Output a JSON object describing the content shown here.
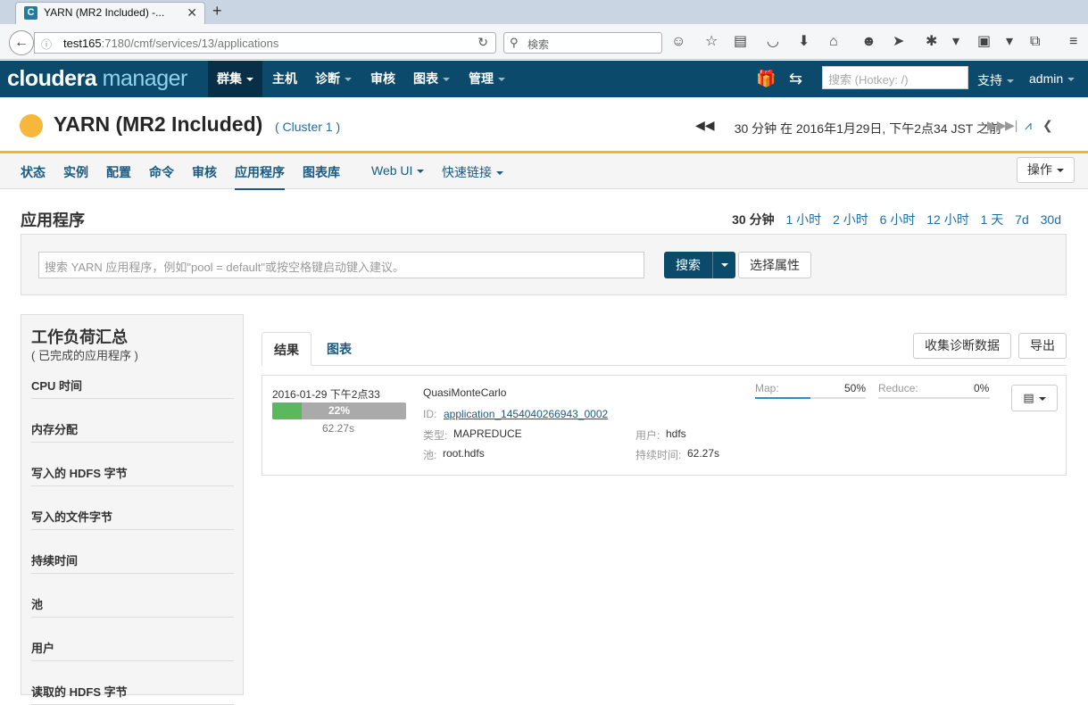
{
  "browser": {
    "tab_title": "YARN (MR2 Included) -...",
    "tab_icon": "cloudera-favicon-icon",
    "url_host": "test165",
    "url_path": ":7180/cmf/services/13/applications",
    "search_placeholder": "検索"
  },
  "header": {
    "logo_brand": "cloudera",
    "logo_product": "manager",
    "nav": [
      {
        "label": "群集",
        "active": true
      },
      {
        "label": "主机"
      },
      {
        "label": "诊断"
      },
      {
        "label": "审核"
      },
      {
        "label": "图表"
      },
      {
        "label": "管理"
      }
    ],
    "search_placeholder": "搜索 (Hotkey: /)",
    "support": "支持",
    "user": "admin"
  },
  "service": {
    "title": "YARN (MR2 Included)",
    "cluster": "( Cluster 1 )",
    "status_color": "#f6b73c",
    "time_window": "30 分钟 在 2016年1月29日, 下午2点34 JST 之前"
  },
  "subnav": {
    "items": [
      "状态",
      "实例",
      "配置",
      "命令",
      "审核",
      "应用程序",
      "图表库"
    ],
    "active": "应用程序",
    "webui": "Web UI",
    "quicklinks": "快速链接",
    "actions": "操作"
  },
  "page": {
    "title": "应用程序",
    "ranges": [
      "30 分钟",
      "1 小时",
      "2 小时",
      "6 小时",
      "12 小时",
      "1 天",
      "7d",
      "30d"
    ],
    "selected_range": "30 分钟",
    "query_placeholder": "搜索 YARN 应用程序，例如\"pool = default\"或按空格键启动键入建议。",
    "search_button": "搜索",
    "attr_button": "选择属性"
  },
  "sidebar": {
    "title": "工作负荷汇总",
    "subtitle": "( 已完成的应用程序 )",
    "items": [
      "CPU 时间",
      "内存分配",
      "写入的 HDFS 字节",
      "写入的文件字节",
      "持续时间",
      "池",
      "用户",
      "读取的 HDFS 字节"
    ]
  },
  "results": {
    "tabs": [
      "结果",
      "图表"
    ],
    "collect_button": "收集诊断数据",
    "export_button": "导出",
    "app": {
      "start": "2016-01-29 下午2点33",
      "progress": 22,
      "progress_label": "22%",
      "duration_short": "62.27s",
      "name": "QuasiMonteCarlo",
      "id_label": "ID:",
      "id": "application_1454040266943_0002",
      "type_label": "类型:",
      "type": "MAPREDUCE",
      "pool_label": "池:",
      "pool": "root.hdfs",
      "user_label": "用户:",
      "user": "hdfs",
      "dur_label": "持续时间:",
      "duration": "62.27s",
      "map_label": "Map:",
      "map_pct": "50%",
      "map_fraction": 0.5,
      "reduce_label": "Reduce:",
      "reduce_pct": "0%",
      "reduce_fraction": 0
    }
  }
}
